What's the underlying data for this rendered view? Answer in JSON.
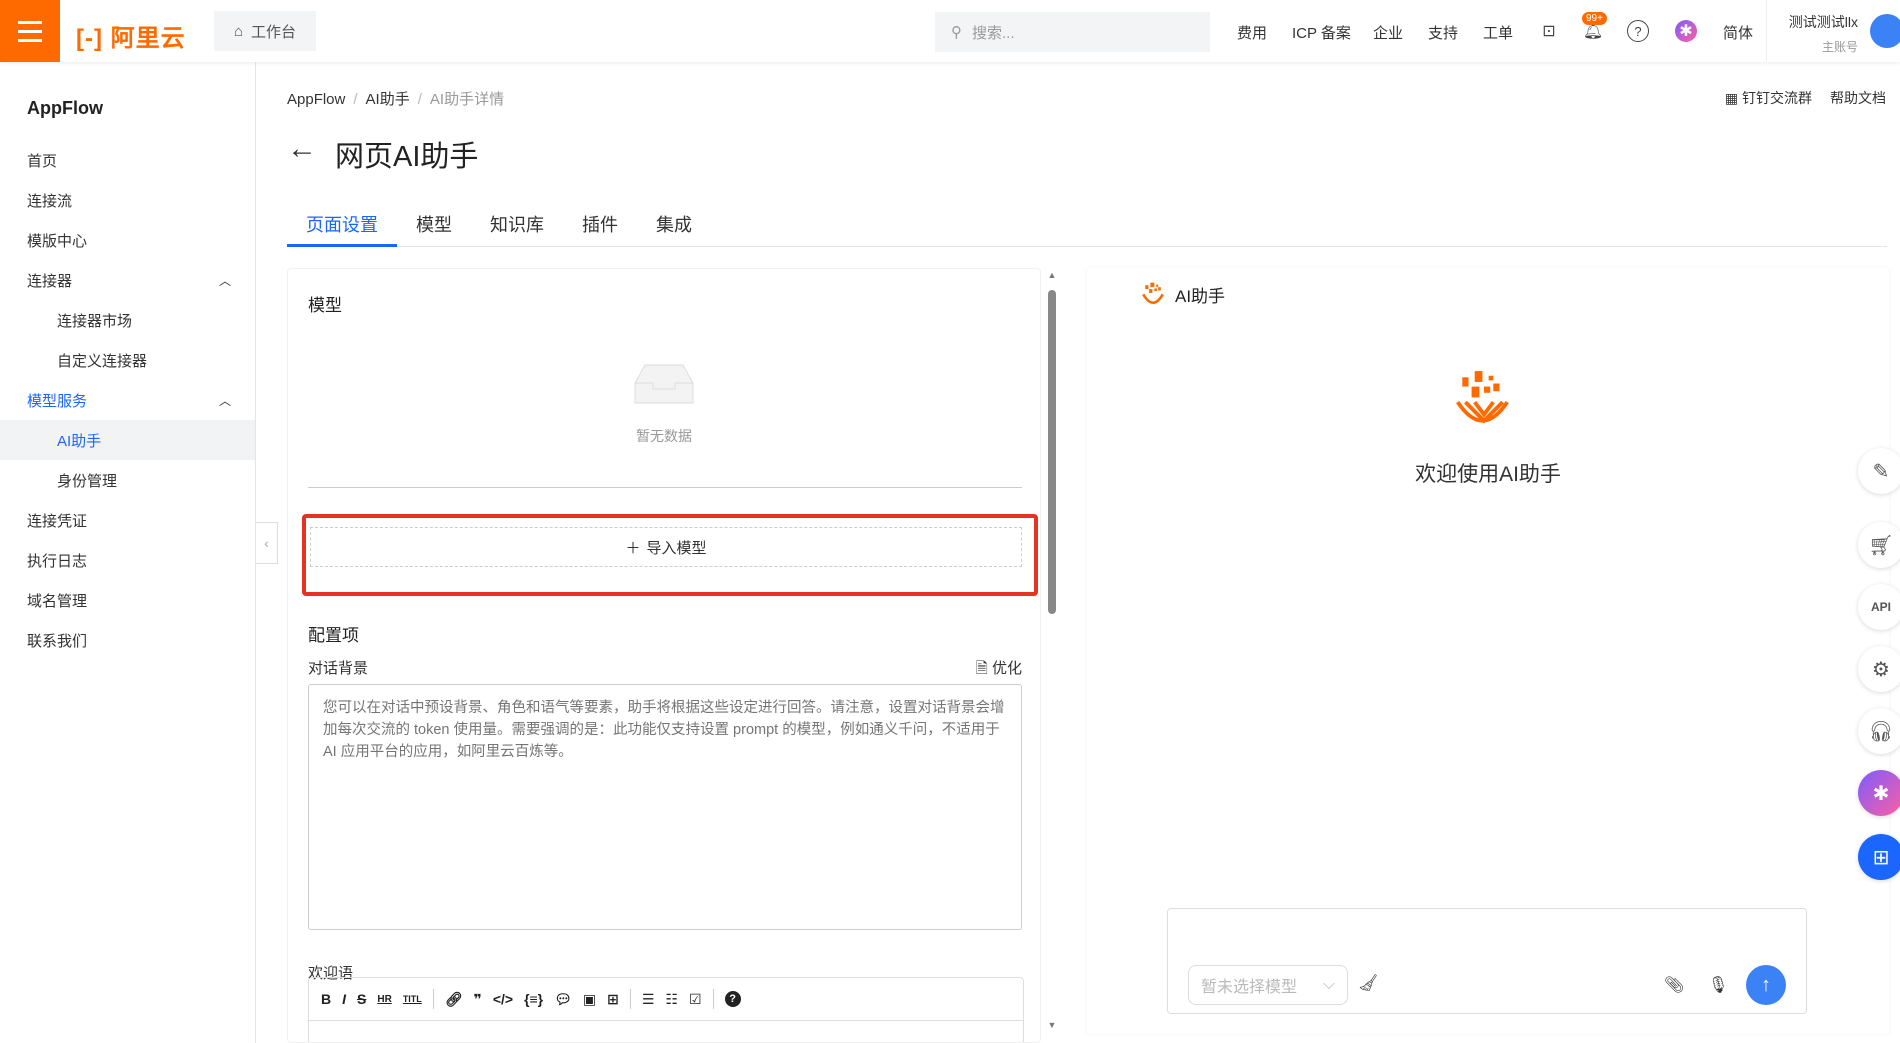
{
  "header": {
    "logo": "阿里云",
    "workbench": "工作台",
    "search_placeholder": "搜索...",
    "nav": [
      "费用",
      "ICP 备案",
      "企业",
      "支持",
      "工单"
    ],
    "badge": "99+",
    "lang": "简体",
    "user": "测试测试llx",
    "account_type": "主账号"
  },
  "sidebar": {
    "title": "AppFlow",
    "items": [
      {
        "label": "首页"
      },
      {
        "label": "连接流"
      },
      {
        "label": "模版中心"
      },
      {
        "label": "连接器"
      },
      {
        "label": "连接器市场"
      },
      {
        "label": "自定义连接器"
      },
      {
        "label": "模型服务"
      },
      {
        "label": "AI助手"
      },
      {
        "label": "身份管理"
      },
      {
        "label": "连接凭证"
      },
      {
        "label": "执行日志"
      },
      {
        "label": "域名管理"
      },
      {
        "label": "联系我们"
      }
    ]
  },
  "breadcrumb": [
    "AppFlow",
    "AI助手",
    "AI助手详情"
  ],
  "top_links": {
    "dingtalk": "钉钉交流群",
    "help": "帮助文档"
  },
  "page_title": "网页AI助手",
  "tabs": [
    "页面设置",
    "模型",
    "知识库",
    "插件",
    "集成"
  ],
  "model_section": {
    "title": "模型",
    "empty": "暂无数据",
    "import": "导入模型"
  },
  "config": {
    "title": "配置项",
    "bg_label": "对话背景",
    "optimize": "优化",
    "bg_placeholder": "您可以在对话中预设背景、角色和语气等要素，助手将根据这些设定进行回答。请注意，设置对话背景会增加每次交流的 token 使用量。需要强调的是：此功能仅支持设置 prompt 的模型，例如通义千问，不适用于 AI 应用平台的应用，如阿里云百炼等。",
    "welcome_label": "欢迎语"
  },
  "chat": {
    "title": "AI助手",
    "welcome": "欢迎使用AI助手",
    "model_placeholder": "暂未选择模型"
  },
  "colors": {
    "brand": "#ff6a00",
    "primary": "#1a66ff",
    "highlight": "#e53323"
  }
}
